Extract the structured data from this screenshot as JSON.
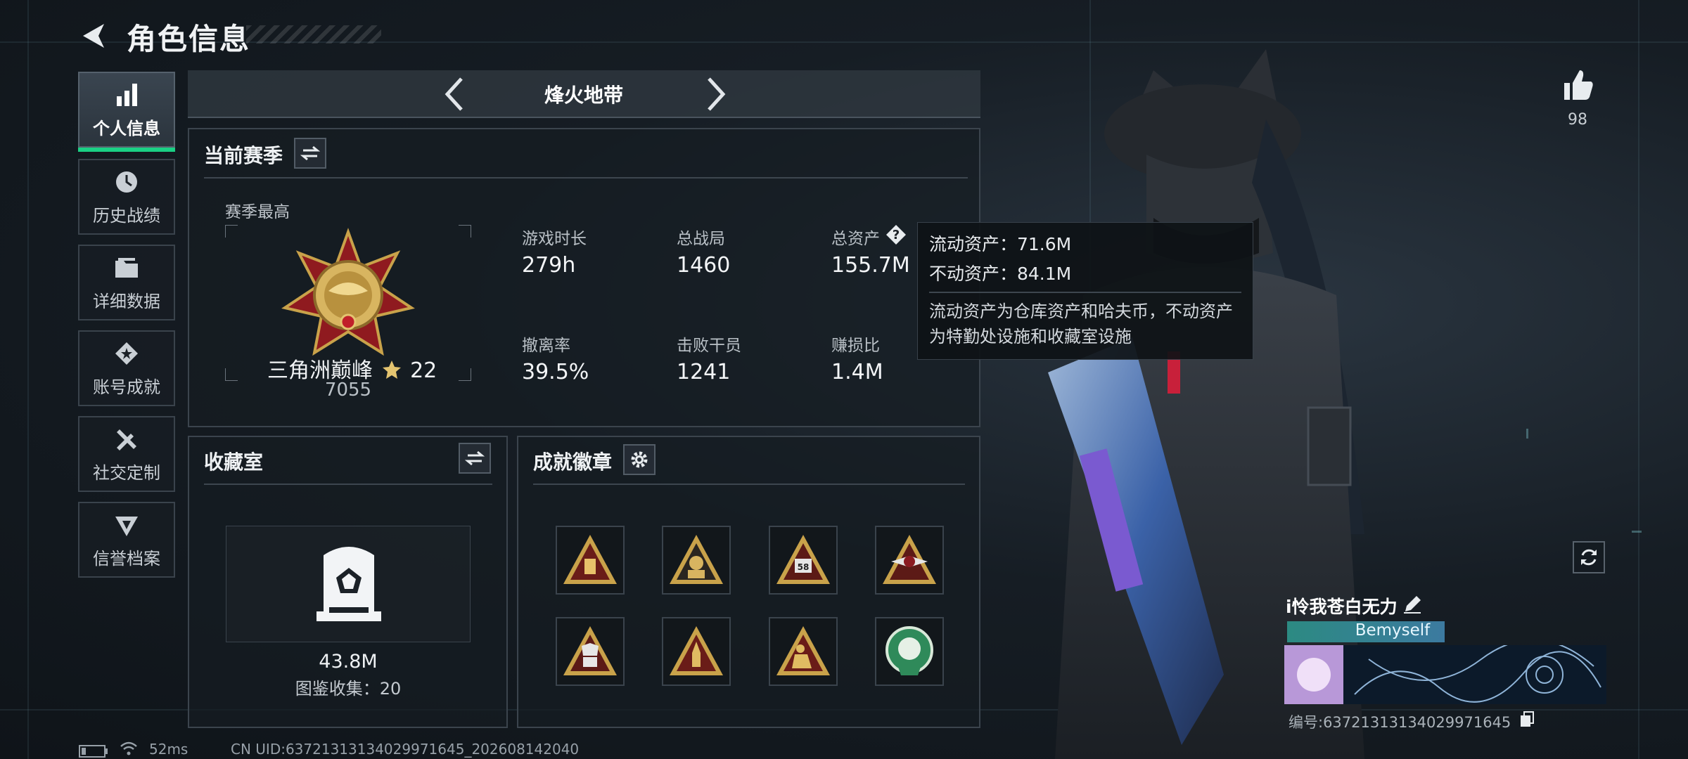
{
  "header": {
    "title": "角色信息"
  },
  "sidebar": {
    "items": [
      {
        "label": "个人信息",
        "icon": "bar-chart-icon",
        "active": true
      },
      {
        "label": "历史战绩",
        "icon": "history-icon"
      },
      {
        "label": "详细数据",
        "icon": "folder-icon"
      },
      {
        "label": "账号成就",
        "icon": "achievement-icon"
      },
      {
        "label": "社交定制",
        "icon": "tools-icon"
      },
      {
        "label": "信誉档案",
        "icon": "reputation-icon"
      }
    ]
  },
  "mode": {
    "title": "烽火地带"
  },
  "season": {
    "title": "当前赛季",
    "best_label": "赛季最高",
    "rank_name": "三角洲巅峰",
    "rank_stars": "22",
    "rank_score": "7055",
    "stats": [
      {
        "label": "游戏时长",
        "value": "279h"
      },
      {
        "label": "总战局",
        "value": "1460"
      },
      {
        "label": "总资产",
        "value": "155.7M"
      },
      {
        "label": "撤离率",
        "value": "39.5%"
      },
      {
        "label": "击败干员",
        "value": "1241"
      },
      {
        "label": "赚损比",
        "value": "1.4M"
      }
    ]
  },
  "tooltip": {
    "liquid": "流动资产：71.6M",
    "fixed": "不动资产：84.1M",
    "desc": "流动资产为仓库资产和哈夫币，不动资产为特勤处设施和收藏室设施"
  },
  "collection": {
    "title": "收藏室",
    "value": "43.8M",
    "count_text": "图鉴收集：20"
  },
  "badges": {
    "title": "成就徽章",
    "items": [
      "badge-ammo",
      "badge-soldier",
      "badge-58",
      "badge-59",
      "badge-56",
      "badge-rocket",
      "badge-kneel",
      "badge-green"
    ]
  },
  "profile": {
    "likes": "98",
    "name": "i怜我苍白无力",
    "tag": "Bemyself",
    "id_text": "编号:6372131313402997164​5"
  },
  "footer": {
    "ping": "52ms",
    "uid": "CN UID:6372131313402997164​5_202608142040"
  },
  "colors": {
    "accent": "#1ad084",
    "gold": "#c9a24a",
    "panel_border": "#3b444d"
  }
}
